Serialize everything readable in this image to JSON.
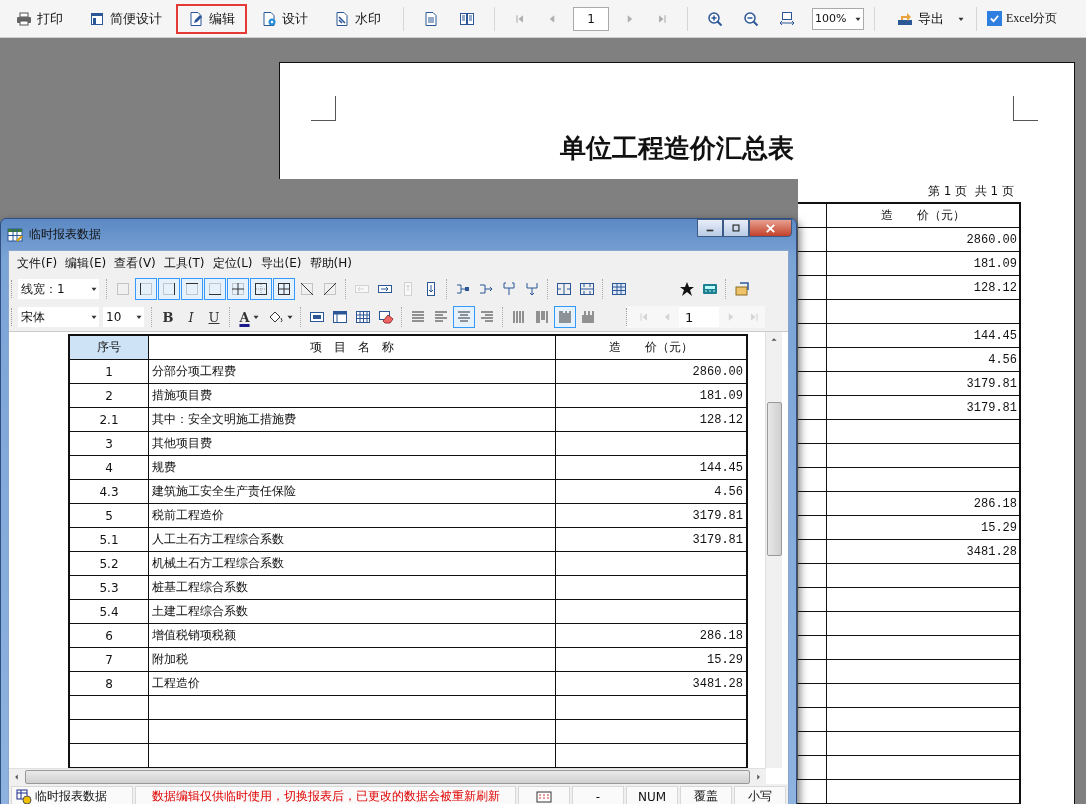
{
  "toolbar": {
    "buttons": [
      {
        "kind": "print",
        "label": "打印",
        "highlighted": false
      },
      {
        "kind": "layout",
        "label": "简便设计",
        "highlighted": false
      },
      {
        "kind": "edit",
        "label": "编辑",
        "highlighted": true
      },
      {
        "kind": "design",
        "label": "设计",
        "highlighted": false
      },
      {
        "kind": "watermark",
        "label": "水印",
        "highlighted": false
      }
    ],
    "view_buttons": [
      {
        "kind": "single-page"
      },
      {
        "kind": "two-page"
      }
    ],
    "nav_back": [
      {
        "kind": "first",
        "disabled": true
      },
      {
        "kind": "prev",
        "disabled": true
      }
    ],
    "page_field": {
      "value": "1"
    },
    "nav_forward": [
      {
        "kind": "next",
        "disabled": true
      },
      {
        "kind": "last",
        "disabled": true
      }
    ],
    "zoom_buttons": [
      {
        "kind": "zoom-in"
      },
      {
        "kind": "zoom-out"
      },
      {
        "kind": "fit-width"
      }
    ],
    "zoom_field": {
      "value": "100%"
    },
    "export": {
      "label": "导出"
    },
    "excel_split": {
      "label": "Excel分页",
      "checked": true
    }
  },
  "page": {
    "title": "单位工程造价汇总表",
    "page_info": "第 1 页  共 1 页",
    "table": {
      "column": "造　　价（元）",
      "rows": [
        {
          "value": "2860.00"
        },
        {
          "value": "181.09"
        },
        {
          "value": "128.12"
        },
        {},
        {
          "value": "144.45"
        },
        {
          "value": "4.56"
        },
        {
          "value": "3179.81"
        },
        {
          "value": "3179.81"
        },
        {},
        {},
        {},
        {
          "value": "286.18"
        },
        {
          "value": "15.29"
        },
        {
          "value": "3481.28"
        },
        {},
        {},
        {},
        {},
        {},
        {},
        {},
        {},
        {},
        {}
      ]
    }
  },
  "dialog": {
    "title": "临时报表数据",
    "menu": [
      "文件(F)",
      "编辑(E)",
      "查看(V)",
      "工具(T)",
      "定位(L)",
      "导出(E)",
      "帮助(H)"
    ],
    "toolbar1": {
      "line_width": "线宽：1",
      "buttons": [
        {
          "kind": "separator"
        },
        {
          "kind": "border-none",
          "selected": false,
          "disabled": false
        },
        {
          "kind": "border-left",
          "selected": true,
          "disabled": false
        },
        {
          "kind": "border-right",
          "selected": true,
          "disabled": false
        },
        {
          "kind": "border-top",
          "selected": true,
          "disabled": false
        },
        {
          "kind": "border-bottom",
          "selected": true,
          "disabled": false
        },
        {
          "kind": "border-inner",
          "selected": true,
          "disabled": false
        },
        {
          "kind": "border-outer",
          "selected": true,
          "disabled": false
        },
        {
          "kind": "border-all",
          "selected": true,
          "disabled": false
        },
        {
          "kind": "diag-down",
          "selected": false,
          "disabled": false
        },
        {
          "kind": "diag-up",
          "selected": false,
          "disabled": false
        },
        {
          "kind": "separator"
        },
        {
          "kind": "insert-col",
          "selected": false,
          "disabled": true
        },
        {
          "kind": "move-right",
          "selected": false,
          "disabled": false
        },
        {
          "kind": "insert-row",
          "selected": false,
          "disabled": true
        },
        {
          "kind": "move-down",
          "selected": false,
          "disabled": false
        },
        {
          "kind": "separator"
        },
        {
          "kind": "branch-right",
          "selected": false,
          "disabled": false
        },
        {
          "kind": "branch-arrow",
          "selected": false,
          "disabled": false
        },
        {
          "kind": "fork",
          "selected": false,
          "disabled": false
        },
        {
          "kind": "fork-down",
          "selected": false,
          "disabled": false
        },
        {
          "kind": "separator"
        },
        {
          "kind": "col-split",
          "selected": false,
          "disabled": false
        },
        {
          "kind": "row-split",
          "selected": false,
          "disabled": false
        },
        {
          "kind": "separator"
        },
        {
          "kind": "table",
          "selected": false,
          "disabled": false
        },
        {
          "kind": "spacer"
        },
        {
          "kind": "star",
          "selected": false,
          "disabled": false
        },
        {
          "kind": "calculator",
          "selected": false,
          "disabled": false
        },
        {
          "kind": "separator"
        },
        {
          "kind": "properties",
          "selected": false,
          "disabled": false
        }
      ]
    },
    "toolbar2": {
      "font": "宋体",
      "size": "10",
      "buttons": [
        {
          "kind": "separator"
        },
        {
          "kind": "bold",
          "label": "B",
          "selected": false
        },
        {
          "kind": "italic",
          "label": "I",
          "selected": false
        },
        {
          "kind": "underline",
          "label": "U",
          "selected": false
        },
        {
          "kind": "separator"
        },
        {
          "kind": "font-color",
          "label": "A",
          "selected": false
        },
        {
          "kind": "fill-color",
          "selected": false
        },
        {
          "kind": "separator"
        },
        {
          "kind": "cell-props",
          "selected": false
        },
        {
          "kind": "insert-table",
          "selected": false
        },
        {
          "kind": "grid",
          "selected": false
        },
        {
          "kind": "eraser",
          "selected": false
        },
        {
          "kind": "separator"
        },
        {
          "kind": "align-justify",
          "selected": false
        },
        {
          "kind": "align-left",
          "selected": false
        },
        {
          "kind": "align-center",
          "selected": true
        },
        {
          "kind": "align-right",
          "selected": false
        },
        {
          "kind": "separator"
        },
        {
          "kind": "bars-even",
          "selected": false
        },
        {
          "kind": "bars-mixed",
          "selected": false
        },
        {
          "kind": "bars-dense",
          "selected": true
        },
        {
          "kind": "bars-tall",
          "selected": false
        }
      ],
      "nav_back": [
        {
          "kind": "first",
          "disabled": true
        },
        {
          "kind": "prev",
          "disabled": true
        }
      ],
      "page_field": "1",
      "nav_forward": [
        {
          "kind": "next",
          "disabled": true
        },
        {
          "kind": "last",
          "disabled": true
        }
      ]
    },
    "table": {
      "columns": [
        "序号",
        "项　目　名　称",
        "造　　价（元）"
      ],
      "rows": [
        {
          "no": "1",
          "name": "分部分项工程费",
          "value": "2860.00"
        },
        {
          "no": "2",
          "name": "措施项目费",
          "value": "181.09"
        },
        {
          "no": "2.1",
          "name": "其中：安全文明施工措施费",
          "value": "128.12"
        },
        {
          "no": "3",
          "name": "其他项目费"
        },
        {
          "no": "4",
          "name": "规费",
          "value": "144.45"
        },
        {
          "no": "4.3",
          "name": "建筑施工安全生产责任保险",
          "value": "4.56"
        },
        {
          "no": "5",
          "name": "税前工程造价",
          "value": "3179.81"
        },
        {
          "no": "5.1",
          "name": "人工土石方工程综合系数",
          "value": "3179.81"
        },
        {
          "no": "5.2",
          "name": "机械土石方工程综合系数"
        },
        {
          "no": "5.3",
          "name": "桩基工程综合系数"
        },
        {
          "no": "5.4",
          "name": "土建工程综合系数"
        },
        {
          "no": "6",
          "name": "增值税销项税额",
          "value": "286.18"
        },
        {
          "no": "7",
          "name": "附加税",
          "value": "15.29"
        },
        {
          "no": "8",
          "name": "工程造价",
          "value": "3481.28"
        }
      ]
    },
    "status_bar": {
      "name": "临时报表数据",
      "message": "数据编辑仅供临时使用，切换报表后，已更改的数据会被重新刷新",
      "cells": [
        {
          "kind": "icon"
        },
        {
          "kind": "text",
          "text": "-"
        },
        {
          "kind": "text",
          "text": "NUM"
        },
        {
          "kind": "text",
          "text": "覆盖"
        },
        {
          "kind": "text",
          "text": "小写"
        }
      ]
    }
  }
}
